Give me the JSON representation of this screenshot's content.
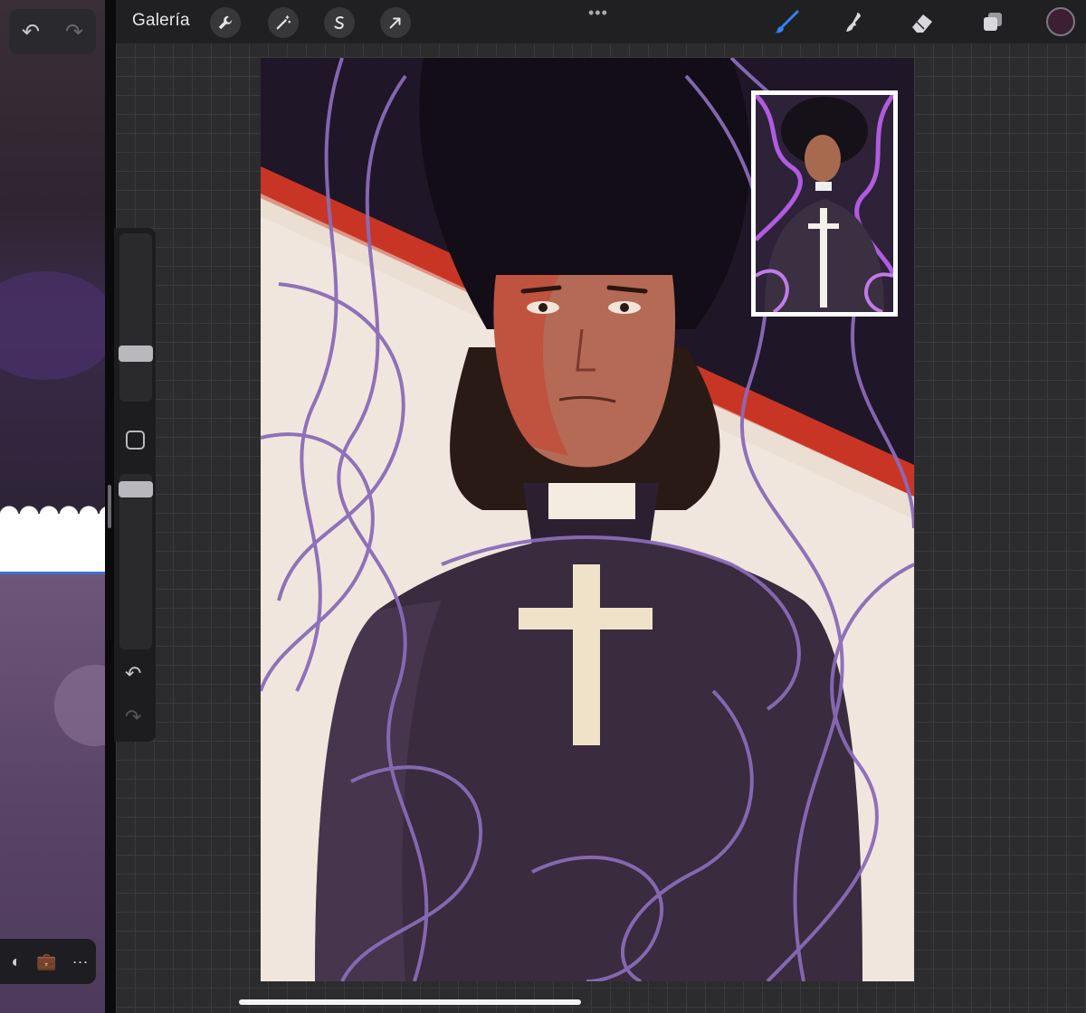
{
  "left_pane": {
    "undo_icon": "undo-arrow",
    "redo_icon": "redo-arrow",
    "toolbar_icons": [
      "briefcase-icon",
      "more-icon"
    ],
    "toolbar_more": "···"
  },
  "topbar": {
    "gallery_label": "Galería",
    "left_tools": [
      "wrench-icon",
      "magic-wand-icon",
      "selection-icon",
      "transform-arrow-icon"
    ],
    "more_label": "•••",
    "right_tools": [
      "brush-icon",
      "smudge-icon",
      "eraser-icon",
      "layers-icon"
    ],
    "active_tool": "brush-icon",
    "current_color": "#3d1f33",
    "accent": "#2f83f2"
  },
  "sidebar": {
    "size_slider_level": 0.25,
    "opacity_slider_level": 0.1,
    "undo_icon": "undo-arrow",
    "redo_icon": "redo-arrow"
  },
  "canvas": {
    "artwork": "priest-portrait",
    "reference_window": true
  }
}
